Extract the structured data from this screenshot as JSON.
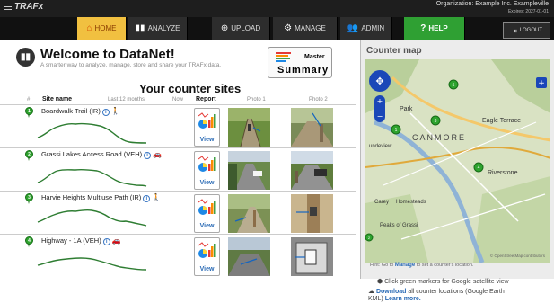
{
  "app": {
    "brand": "TRAFx",
    "org": "Organization: Example Inc. Exampleville",
    "expires": "Expires: 2027-01-01"
  },
  "nav": {
    "home": "HOME",
    "analyze": "ANALYZE",
    "upload": "UPLOAD",
    "manage": "MANAGE",
    "admin": "ADMIN",
    "help": "HELP",
    "logout": "LOGOUT"
  },
  "welcome": {
    "title": "Welcome to DataNet!",
    "tagline": "A smarter way to analyze, manage, store and share your TRAFx data."
  },
  "master": {
    "line1": "Master",
    "line2": "Summary"
  },
  "sites": {
    "title": "Your counter sites",
    "headers": {
      "num": "#",
      "name": "Site name",
      "months": "Last 12 months",
      "now": "Now",
      "report": "Report",
      "photo1": "Photo 1",
      "photo2": "Photo 2"
    },
    "view_label": "View",
    "rows": [
      {
        "num": "1",
        "name": "Boardwalk Trail (IR)",
        "mode": "person"
      },
      {
        "num": "2",
        "name": "Grassi Lakes Access Road (VEH)",
        "mode": "car"
      },
      {
        "num": "3",
        "name": "Harvie Heights Multiuse Path (IR)",
        "mode": "person"
      },
      {
        "num": "4",
        "name": "Highway - 1A (VEH)",
        "mode": "car"
      }
    ]
  },
  "map": {
    "title": "Counter map",
    "labels": {
      "park": "Park",
      "eagle": "Eagle Terrace",
      "canmore": "CANMORE",
      "undeview": "undeview",
      "riverstone": "Riverstone",
      "carey": "Carey",
      "homesteads": "Homesteads",
      "peaks": "Peaks of Grassi"
    },
    "markers": [
      "1",
      "2",
      "3",
      "4",
      "5"
    ],
    "attribution": "© OpenStreetMap contributors",
    "hint_prefix": "Hint: Go to",
    "hint_link": "Manage",
    "hint_suffix": "to set a counter's location.",
    "tip1": "Click green markers for Google satellite view",
    "tip2_link": "Download",
    "tip2_rest": "all counter locations (Google Earth",
    "tip3_start": "KML)",
    "tip3_link": "Learn more."
  }
}
